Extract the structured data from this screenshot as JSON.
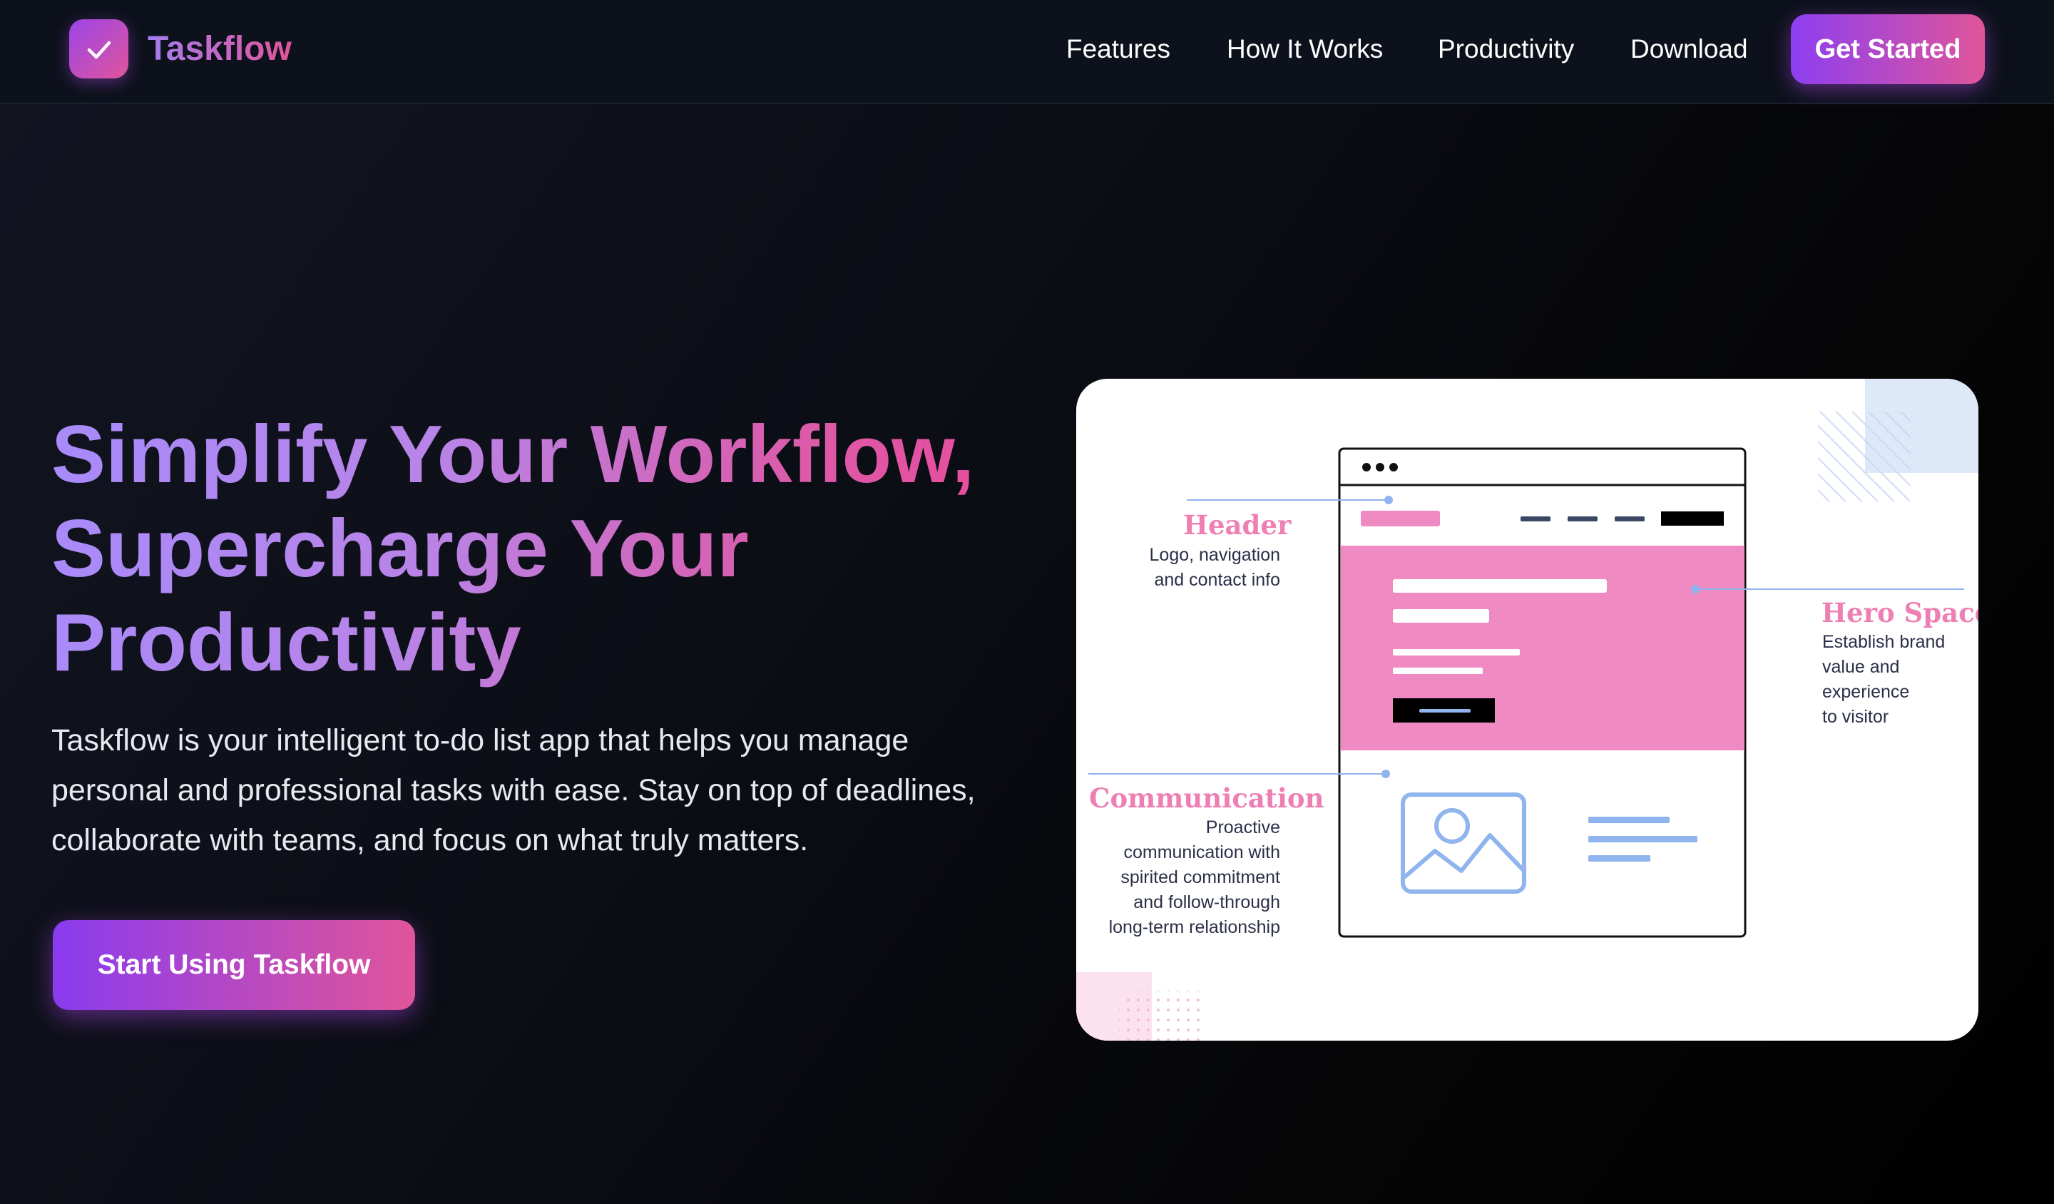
{
  "brand": {
    "name": "Taskflow",
    "logo_icon": "check-icon"
  },
  "nav": {
    "links": [
      "Features",
      "How It Works",
      "Productivity",
      "Download"
    ],
    "cta_label": "Get Started"
  },
  "hero": {
    "title_lines": [
      "Simplify Your Workflow,",
      "Supercharge Your",
      "Productivity"
    ],
    "description": "Taskflow is your intelligent to-do list app that helps you manage personal and professional tasks with ease. Stay on top of deadlines, collaborate with teams, and focus on what truly matters.",
    "cta_label": "Start Using Taskflow"
  },
  "illustration": {
    "header": {
      "title": "Header",
      "lines": [
        "Logo, navigation",
        "and contact info"
      ]
    },
    "hero_space": {
      "title": "Hero Space",
      "lines": [
        "Establish brand",
        "value and",
        "experience",
        "to visitor"
      ]
    },
    "communication": {
      "title": "Communication",
      "lines": [
        "Proactive",
        "communication with",
        "spirited commitment",
        "and follow-through",
        "long-term relationship"
      ]
    },
    "image_icon": "image-icon"
  },
  "colors": {
    "accent_purple": "#8d3ff0",
    "accent_pink": "#e0559a",
    "title_gradient_start": "#a78bfa",
    "illustration_pink": "#ef8bc2",
    "illustration_blue": "#8fb4ee"
  }
}
